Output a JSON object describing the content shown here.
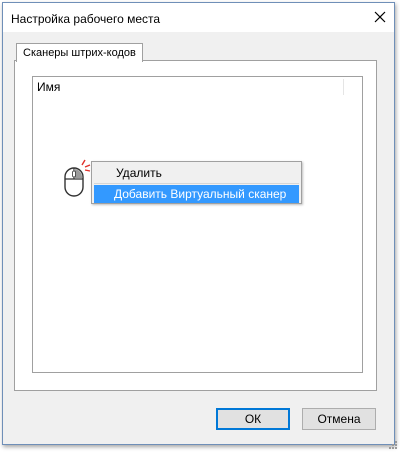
{
  "window": {
    "title": "Настройка рабочего места"
  },
  "tabs": [
    {
      "label": "Сканеры штрих-кодов"
    }
  ],
  "list": {
    "columns": [
      {
        "label": "Имя"
      }
    ]
  },
  "context_menu": {
    "items": [
      {
        "label": "Удалить",
        "selected": false
      },
      {
        "label": "Добавить Виртуальный сканер",
        "selected": true
      }
    ],
    "selected_color": "#3399ff"
  },
  "buttons": {
    "ok_label": "ОК",
    "cancel_label": "Отмена"
  },
  "icons": {
    "close": "close-icon",
    "mouse": "mouse-right-click-icon",
    "grip": "resize-grip-icon"
  }
}
